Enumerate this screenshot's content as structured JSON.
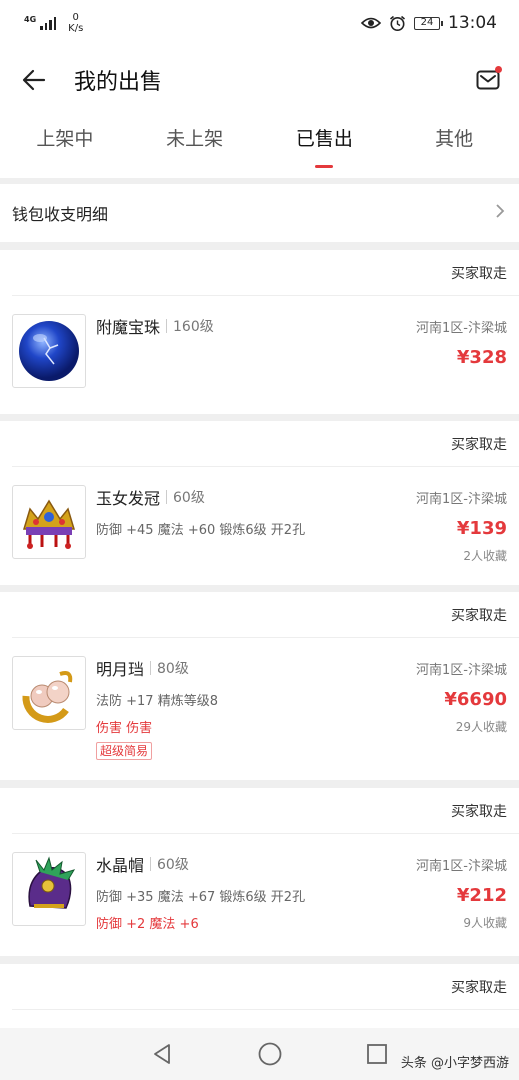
{
  "status_bar": {
    "network": "4G",
    "speed_value": "0",
    "speed_unit": "K/s",
    "battery": "24",
    "time": "13:04"
  },
  "header": {
    "title": "我的出售"
  },
  "tabs": [
    {
      "label": "上架中",
      "active": false
    },
    {
      "label": "未上架",
      "active": false
    },
    {
      "label": "已售出",
      "active": true
    },
    {
      "label": "其他",
      "active": false
    }
  ],
  "wallet": {
    "label": "钱包收支明细"
  },
  "colors": {
    "accent": "#e4393c"
  },
  "items": [
    {
      "status": "买家取走",
      "name": "附魔宝珠",
      "level": "160级",
      "server": "河南1区-汴梁城",
      "attrs": "",
      "price": "¥328",
      "red_attrs": "",
      "favorites": "",
      "tag": "",
      "icon": "blue-orb-icon"
    },
    {
      "status": "买家取走",
      "name": "玉女发冠",
      "level": "60级",
      "server": "河南1区-汴梁城",
      "attrs": "防御 +45 魔法 +60 锻炼6级 开2孔",
      "price": "¥139",
      "red_attrs": "",
      "favorites": "2人收藏",
      "tag": "",
      "icon": "crown-icon"
    },
    {
      "status": "买家取走",
      "name": "明月珰",
      "level": "80级",
      "server": "河南1区-汴梁城",
      "attrs": "法防 +17 精炼等级8",
      "price": "¥6690",
      "red_attrs": "伤害 伤害",
      "favorites": "29人收藏",
      "tag": "超级简易",
      "icon": "earring-icon"
    },
    {
      "status": "买家取走",
      "name": "水晶帽",
      "level": "60级",
      "server": "河南1区-汴梁城",
      "attrs": "防御 +35 魔法 +67 锻炼6级 开2孔",
      "price": "¥212",
      "red_attrs": "防御 +2 魔法 +6",
      "favorites": "9人收藏",
      "tag": "",
      "icon": "crystal-hat-icon"
    },
    {
      "status": "买家取走"
    }
  ],
  "watermark": "头条 @小字梦西游"
}
